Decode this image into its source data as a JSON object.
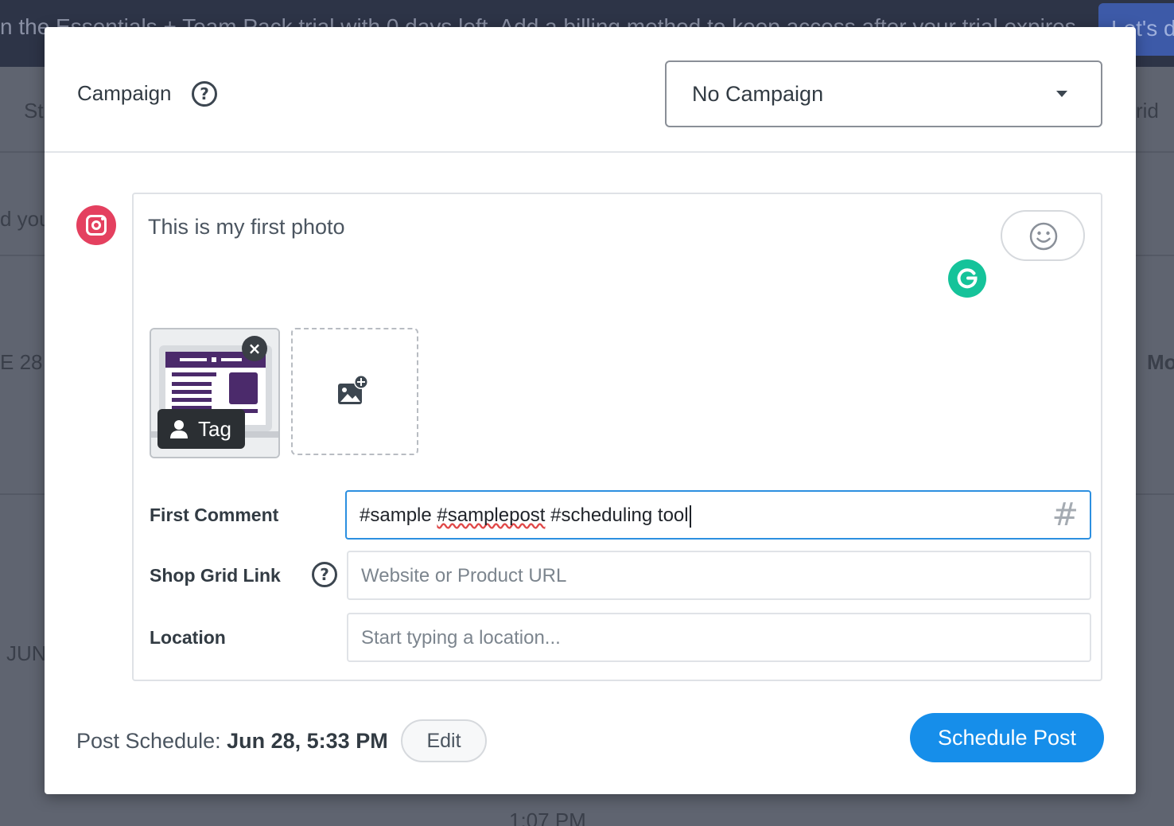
{
  "background": {
    "banner_text": "n the Essentials + Team Pack trial with 0 days left. Add a billing method to keep access after your trial expires.",
    "banner_button": "Let's do it",
    "fragments": {
      "left_tab": "St",
      "left_text": "d you",
      "date_left": "E 28",
      "date_left2": "JUN",
      "right_tab": "rid",
      "right_btn": "Mo",
      "time_bottom": "1:07 PM"
    }
  },
  "modal": {
    "campaign": {
      "label": "Campaign",
      "help_glyph": "?",
      "selected": "No Campaign"
    },
    "composer": {
      "network_icon": "instagram-icon",
      "caption": "This is my first photo",
      "media": {
        "remove_glyph": "×",
        "tag_label": "Tag"
      },
      "first_comment": {
        "label": "First Comment",
        "value_plain": "#sample ",
        "value_misspelled": "#samplepost",
        "value_rest": " #scheduling tool",
        "hash_glyph": "#"
      },
      "shop_grid_link": {
        "label": "Shop Grid Link",
        "help_glyph": "?",
        "placeholder": "Website or Product URL"
      },
      "location": {
        "label": "Location",
        "placeholder": "Start typing a location..."
      }
    },
    "footer": {
      "schedule_label": "Post Schedule: ",
      "schedule_value": "Jun 28, 5:33 PM",
      "edit_label": "Edit",
      "submit_label": "Schedule Post"
    }
  },
  "colors": {
    "primary": "#168eea",
    "instagram": "#e4405f",
    "grammarly": "#15c39a",
    "focus_border": "#2c8fe0"
  }
}
